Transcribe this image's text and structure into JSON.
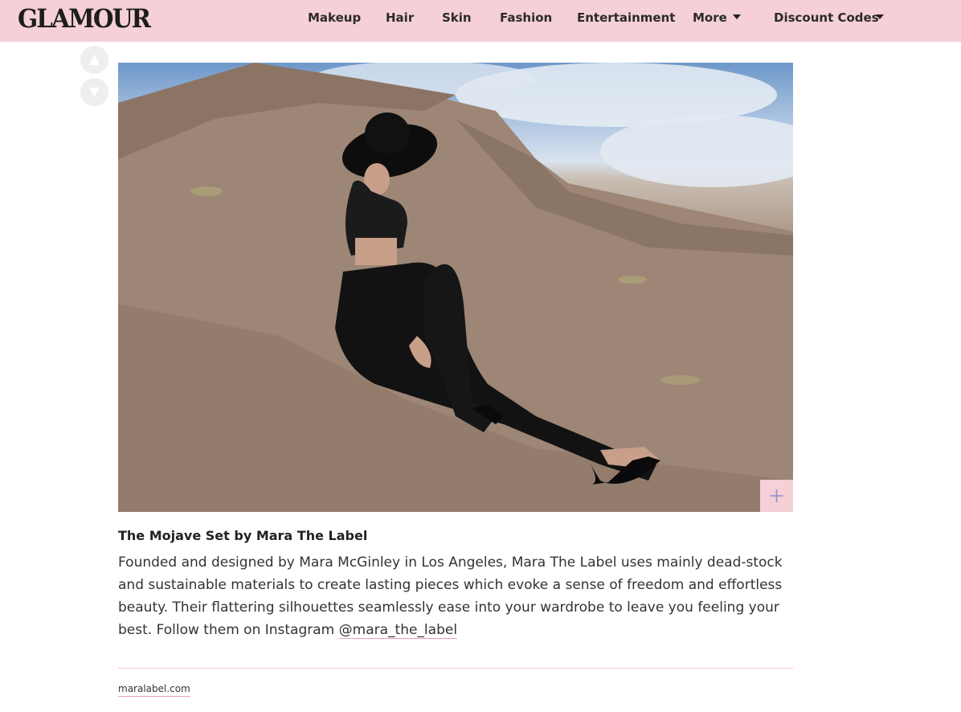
{
  "header": {
    "logo": "GLAMOUR",
    "nav": [
      {
        "label": "Makeup"
      },
      {
        "label": "Hair"
      },
      {
        "label": "Skin"
      },
      {
        "label": "Fashion"
      },
      {
        "label": "Entertainment"
      },
      {
        "label": "More",
        "has_dropdown": true
      },
      {
        "label": "Discount Codes",
        "has_dropdown": true
      }
    ]
  },
  "votes": {
    "up_icon": "triangle-up-icon",
    "down_icon": "triangle-down-icon"
  },
  "product": {
    "image_alt": "Model in black outfit and wide-brim hat sitting on desert rock",
    "title": "The Mojave Set by Mara The Label",
    "description": "Founded and designed by Mara McGinley in Los Angeles, Mara The Label uses mainly dead-stock and sustainable materials to create lasting pieces which evoke a sense of freedom and effortless beauty. Their flattering silhouettes seamlessly ease into your wardrobe to leave you feeling your best. Follow them on Instagram ",
    "instagram_handle": "@mara_the_label",
    "source_link": "maralabel.com"
  },
  "colors": {
    "header_bg": "#f5d0d6",
    "accent": "#e8a0ad",
    "expand_icon": "#8e8fd0"
  }
}
